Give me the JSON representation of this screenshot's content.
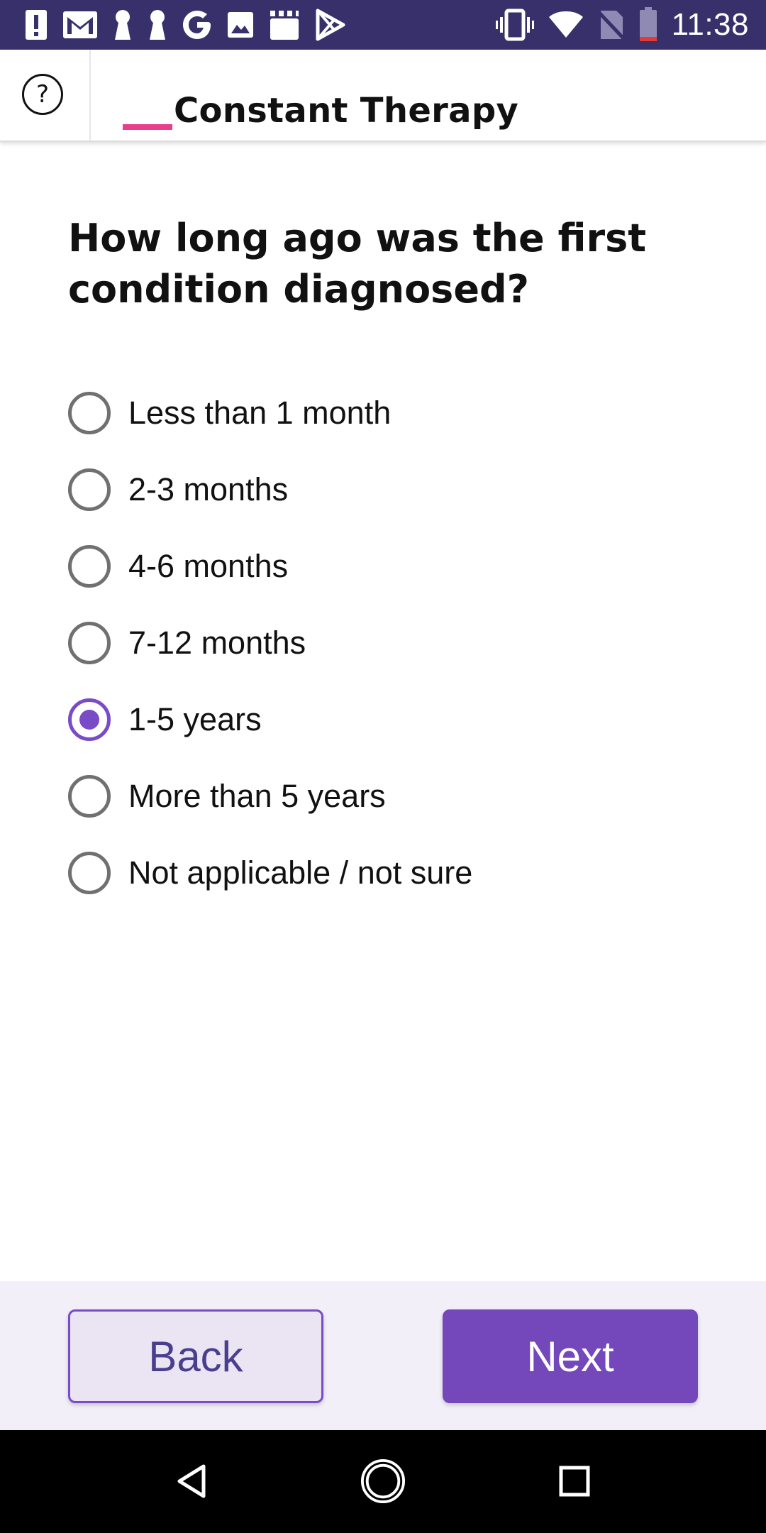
{
  "status_bar": {
    "time": "11:38",
    "left_icons": [
      "alert-icon",
      "gmail-icon",
      "keyhole-icon",
      "keyhole-icon",
      "google-icon",
      "image-icon",
      "calendar-icon",
      "play-icon"
    ],
    "right_icons": [
      "vibrate-icon",
      "wifi-icon",
      "no-sim-icon",
      "battery-low-icon"
    ]
  },
  "header": {
    "help_symbol": "?",
    "brand_name": "Constant Therapy",
    "accent_color": "#e83e8c"
  },
  "question": {
    "prefix": "How long ago was the ",
    "emphasis": "first",
    "suffix": " condition diagnosed?"
  },
  "options": [
    {
      "label": "Less than 1 month",
      "selected": false
    },
    {
      "label": "2-3 months",
      "selected": false
    },
    {
      "label": "4-6 months",
      "selected": false
    },
    {
      "label": "7-12 months",
      "selected": false
    },
    {
      "label": "1-5 years",
      "selected": true
    },
    {
      "label": "More than 5 years",
      "selected": false
    },
    {
      "label": "Not applicable / not sure",
      "selected": false
    }
  ],
  "footer": {
    "back_label": "Back",
    "next_label": "Next",
    "primary_color": "#7447bb"
  },
  "nav_bar": {
    "icons": [
      "back-triangle-icon",
      "home-circle-icon",
      "recents-square-icon"
    ]
  }
}
